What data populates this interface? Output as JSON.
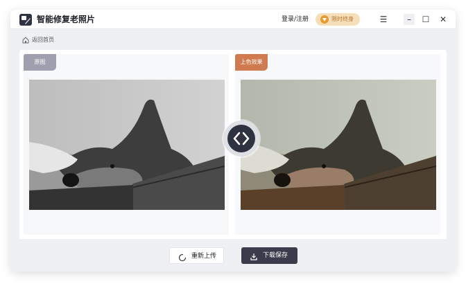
{
  "app": {
    "title": "智能修复老照片"
  },
  "header": {
    "login_label": "登录/注册",
    "vip_label": "限时终身",
    "vip_icon": "gem-icon"
  },
  "window_controls": {
    "menu": "☰",
    "minimize": "–",
    "maximize": "☐",
    "close": "✕"
  },
  "nav": {
    "back_label": "返回首页",
    "back_icon": "home-icon"
  },
  "panels": {
    "original_label": "原图",
    "colorized_label": "上色效果"
  },
  "actions": {
    "reupload_label": "重新上传",
    "save_label": "下载保存"
  },
  "colors": {
    "accent_orange": "#d07a4f",
    "tag_gray": "#9ea0ae",
    "dark": "#3a3b4b",
    "vip_bg": "#f6dfb8"
  }
}
